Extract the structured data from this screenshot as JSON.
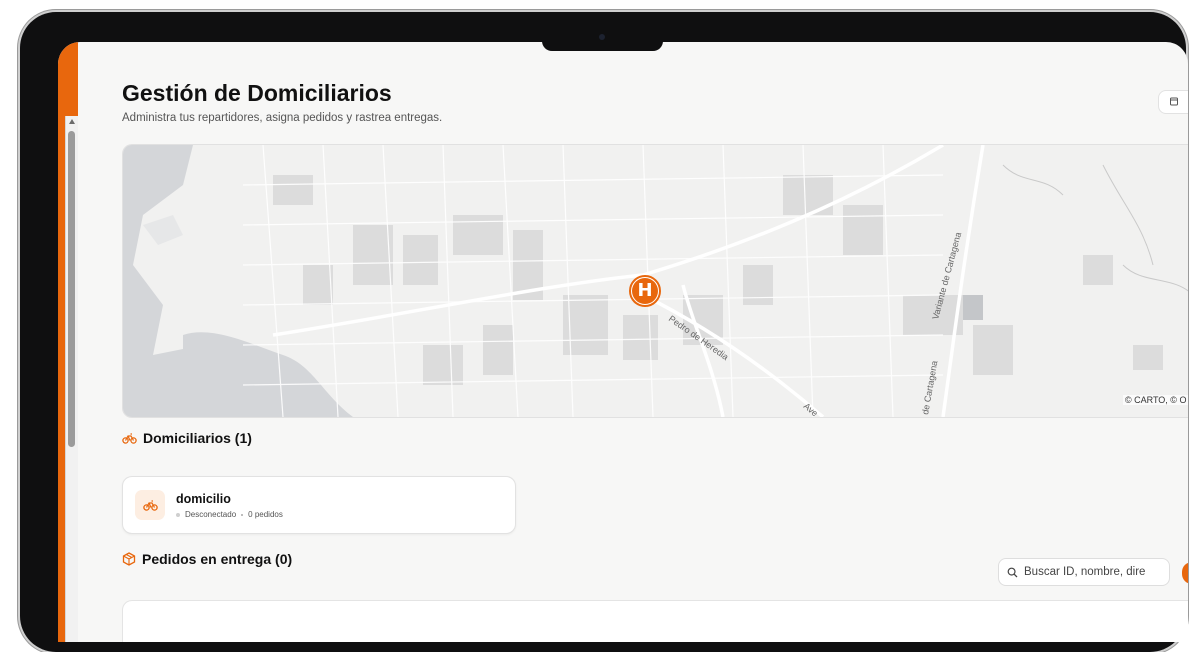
{
  "page": {
    "title": "Gestión de Domiciliarios",
    "subtitle": "Administra tus repartidores, asigna pedidos y rastrea entregas."
  },
  "map": {
    "attribution": "© CARTO, © O",
    "marker_label": "H",
    "street_labels": [
      "Pedro de Heredia",
      "Variante de Cartagena",
      "de Cartagena",
      "Ave"
    ]
  },
  "couriers_section": {
    "title": "Domiciliarios (1)",
    "items": [
      {
        "name": "domicilio",
        "status": "Desconectado",
        "orders": "0 pedidos"
      }
    ]
  },
  "orders_section": {
    "title": "Pedidos en entrega (0)",
    "search": {
      "placeholder": "Buscar ID, nombre, dire",
      "value": ""
    }
  },
  "colors": {
    "accent": "#e8670d",
    "accent_soft": "#fdeee2",
    "background": "#f7f7f6",
    "status_offline": "#cfcfcf"
  },
  "icons": {
    "couriers_section": "bike-icon",
    "orders_section": "package-icon",
    "search": "search-icon",
    "top_right": "calendar-icon"
  }
}
